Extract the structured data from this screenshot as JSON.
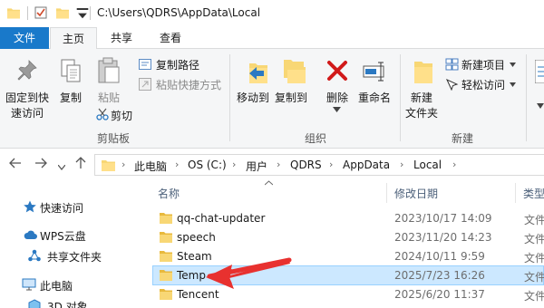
{
  "window": {
    "title": "C:\\Users\\QDRS\\AppData\\Local"
  },
  "tabs": {
    "file": "文件",
    "home": "主页",
    "share": "共享",
    "view": "查看"
  },
  "ribbon": {
    "clipboard": {
      "pin": [
        "固定到快",
        "速访问"
      ],
      "copy": "复制",
      "paste": "粘贴",
      "copy_path": "复制路径",
      "paste_shortcut": "粘贴快捷方式",
      "cut": "剪切",
      "group": "剪贴板"
    },
    "organize": {
      "move_to": "移动到",
      "copy_to": "复制到",
      "delete": "删除",
      "rename": "重命名",
      "group": "组织"
    },
    "new": {
      "new_folder": [
        "新建",
        "文件夹"
      ],
      "new_item": "新建项目",
      "easy_access": "轻松访问",
      "group": "新建"
    }
  },
  "address": {
    "crumbs": [
      "此电脑",
      "OS (C:)",
      "用户",
      "QDRS",
      "AppData",
      "Local"
    ]
  },
  "nav": {
    "items": [
      {
        "label": "快速访问",
        "icon": "star-icon"
      },
      {
        "label": "WPS云盘",
        "icon": "cloud-icon"
      },
      {
        "label": "共享文件夹",
        "icon": "share-folder-icon"
      },
      {
        "label": "此电脑",
        "icon": "computer-icon"
      },
      {
        "label": "3D 对象",
        "icon": "3d-objects-icon"
      }
    ]
  },
  "filelist": {
    "columns": {
      "name": "名称",
      "modified": "修改日期",
      "type": "类型"
    },
    "rows": [
      {
        "name": "qq-chat-updater",
        "modified": "2023/10/17 14:09",
        "type": "文件"
      },
      {
        "name": "speech",
        "modified": "2023/11/20 14:23",
        "type": "文件"
      },
      {
        "name": "Steam",
        "modified": "2024/10/11 9:59",
        "type": "文件"
      },
      {
        "name": "Temp",
        "modified": "2025/7/23 16:26",
        "type": "文件",
        "selected": true
      },
      {
        "name": "Tencent",
        "modified": "2025/6/20 11:37",
        "type": "文件"
      }
    ]
  },
  "colors": {
    "accent": "#1979ca",
    "selection": "#cce8ff",
    "folder": "#f8d775",
    "annotation_arrow": "#e8312f"
  }
}
